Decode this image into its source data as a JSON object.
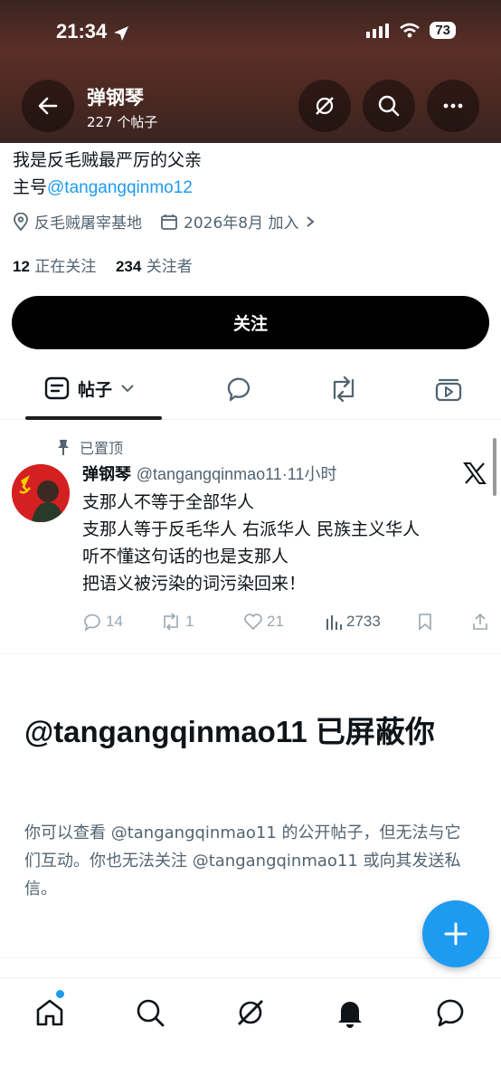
{
  "status_bar": {
    "time": "21:34",
    "battery": "73"
  },
  "header": {
    "name": "弹钢琴",
    "post_count": "227 个帖子"
  },
  "profile": {
    "bio_line1": "我是反毛贼最严厉的父亲",
    "bio_line2_prefix": "主号",
    "bio_line2_link": "@tangangqinmo12",
    "location": "反毛贼屠宰基地",
    "joined": "2026年8月 加入",
    "following_count": "12",
    "following_label": "正在关注",
    "followers_count": "234",
    "followers_label": "关注者",
    "follow_button": "关注"
  },
  "tabs": {
    "posts_label": "帖子"
  },
  "pinned_post": {
    "pinned_label": "已置顶",
    "name": "弹钢琴",
    "handle": "@tangangqinmao11",
    "time": "·11小时",
    "lines": [
      "支那人不等于全部华人",
      "支那人等于反毛华人 右派华人 民族主义华人",
      "听不懂这句话的也是支那人",
      "把语义被污染的词污染回来！"
    ],
    "replies": "14",
    "reposts": "1",
    "likes": "21",
    "views": "2733"
  },
  "blocked": {
    "title": "@tangangqinmao11 已屏蔽你",
    "text": "你可以查看 @tangangqinmao11 的公开帖子，但无法与它们互动。你也无法关注 @tangangqinmao11 或向其发送私信。"
  },
  "colors": {
    "accent": "#1d9bf0",
    "text": "#0f1419",
    "muted": "#536471"
  }
}
